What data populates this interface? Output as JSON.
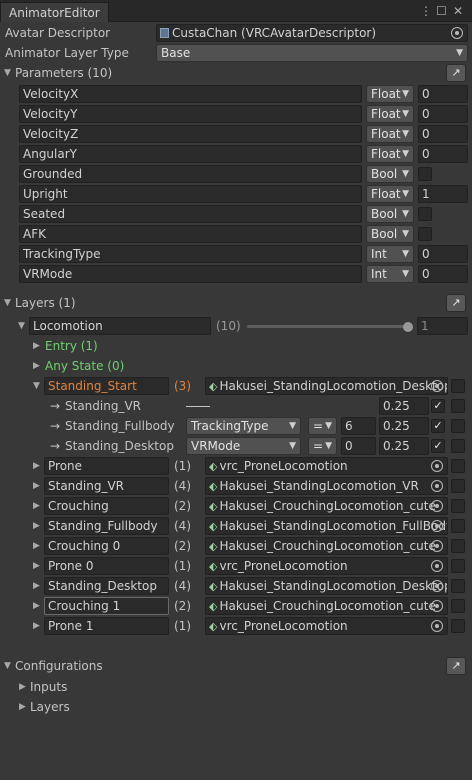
{
  "window": {
    "tab_title": "AnimatorEditor",
    "menu_icon": "kebab-menu-icon",
    "maximize_icon": "maximize-icon",
    "close_icon": "close-icon"
  },
  "avatar_descriptor": {
    "label": "Avatar Descriptor",
    "value": "CustaChan (VRCAvatarDescriptor)"
  },
  "layer_type": {
    "label": "Animator Layer Type",
    "value": "Base"
  },
  "parameters": {
    "header": "Parameters (10)",
    "items": [
      {
        "name": "VelocityX",
        "type": "Float",
        "value": "0"
      },
      {
        "name": "VelocityY",
        "type": "Float",
        "value": "0"
      },
      {
        "name": "VelocityZ",
        "type": "Float",
        "value": "0"
      },
      {
        "name": "AngularY",
        "type": "Float",
        "value": "0"
      },
      {
        "name": "Grounded",
        "type": "Bool",
        "value": ""
      },
      {
        "name": "Upright",
        "type": "Float",
        "value": "1"
      },
      {
        "name": "Seated",
        "type": "Bool",
        "value": ""
      },
      {
        "name": "AFK",
        "type": "Bool",
        "value": ""
      },
      {
        "name": "TrackingType",
        "type": "Int",
        "value": "0"
      },
      {
        "name": "VRMode",
        "type": "Int",
        "value": "0"
      }
    ]
  },
  "layers": {
    "header": "Layers (1)",
    "layer": {
      "name": "Locomotion",
      "weight_label": "(10)",
      "weight_value": "1"
    },
    "entry": "Entry (1)",
    "any_state": "Any State (0)",
    "start_state": {
      "name": "Standing_Start",
      "count": "(3)",
      "motion": "Hakusei_StandingLocomotion_Desktop"
    },
    "transitions": [
      {
        "target": "Standing_VR",
        "param": "",
        "op": "",
        "value": "",
        "duration": "0.25"
      },
      {
        "target": "Standing_Fullbody",
        "param": "TrackingType",
        "op": "=",
        "value": "6",
        "duration": "0.25"
      },
      {
        "target": "Standing_Desktop",
        "param": "VRMode",
        "op": "=",
        "value": "0",
        "duration": "0.25"
      }
    ],
    "states": [
      {
        "name": "Prone",
        "count": "(1)",
        "motion": "vrc_ProneLocomotion"
      },
      {
        "name": "Standing_VR",
        "count": "(4)",
        "motion": "Hakusei_StandingLocomotion_VR"
      },
      {
        "name": "Crouching",
        "count": "(2)",
        "motion": "Hakusei_CrouchingLocomotion_cute"
      },
      {
        "name": "Standing_Fullbody",
        "count": "(4)",
        "motion": "Hakusei_StandingLocomotion_FullBody"
      },
      {
        "name": "Crouching 0",
        "count": "(2)",
        "motion": "Hakusei_CrouchingLocomotion_cute"
      },
      {
        "name": "Prone 0",
        "count": "(1)",
        "motion": "vrc_ProneLocomotion"
      },
      {
        "name": "Standing_Desktop",
        "count": "(4)",
        "motion": "Hakusei_StandingLocomotion_Desktop"
      },
      {
        "name": "Crouching 1",
        "count": "(2)",
        "motion": "Hakusei_CrouchingLocomotion_cute"
      },
      {
        "name": "Prone 1",
        "count": "(1)",
        "motion": "vrc_ProneLocomotion"
      }
    ]
  },
  "configurations": {
    "header": "Configurations",
    "items": [
      "Inputs",
      "Layers"
    ]
  },
  "colors": {
    "background": "#383838",
    "field": "#2a2a2a",
    "entry_green": "#6fcf6f",
    "start_orange": "#e0833e"
  }
}
